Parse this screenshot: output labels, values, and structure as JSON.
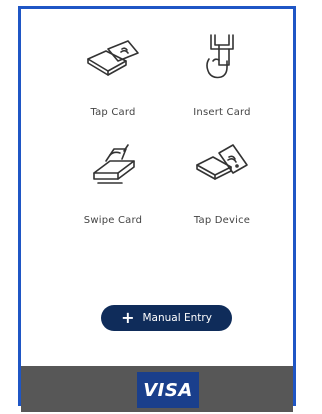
{
  "options": [
    {
      "label": "Tap Card",
      "icon": "tap-card-icon"
    },
    {
      "label": "Insert Card",
      "icon": "insert-card-icon"
    },
    {
      "label": "Swipe Card",
      "icon": "swipe-card-icon"
    },
    {
      "label": "Tap Device",
      "icon": "tap-device-icon"
    }
  ],
  "manual_entry": {
    "label": "Manual Entry",
    "icon": "plus-icon"
  },
  "footer": {
    "brand": "VISA",
    "brand_color": "#1a3f8c",
    "background": "#575757"
  },
  "colors": {
    "accent": "#0f2c5a",
    "frame": "#1f56c5"
  }
}
